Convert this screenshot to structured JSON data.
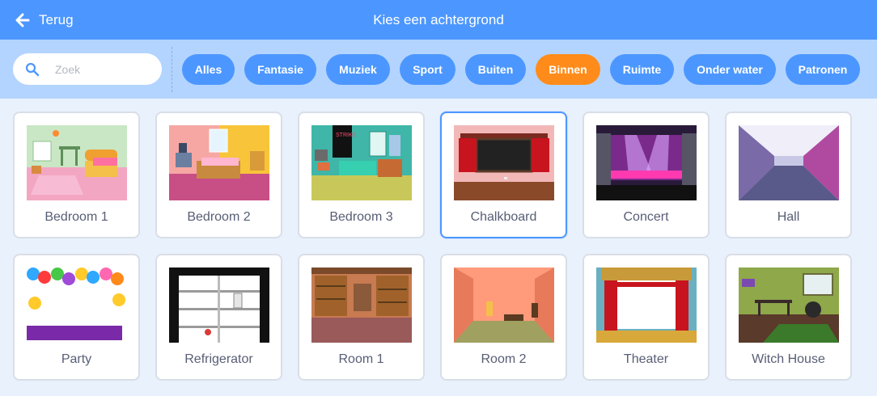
{
  "header": {
    "back_label": "Terug",
    "title": "Kies een achtergrond"
  },
  "search": {
    "placeholder": "Zoek",
    "value": ""
  },
  "tags": [
    {
      "label": "Alles",
      "active": false
    },
    {
      "label": "Fantasie",
      "active": false
    },
    {
      "label": "Muziek",
      "active": false
    },
    {
      "label": "Sport",
      "active": false
    },
    {
      "label": "Buiten",
      "active": false
    },
    {
      "label": "Binnen",
      "active": true
    },
    {
      "label": "Ruimte",
      "active": false
    },
    {
      "label": "Onder water",
      "active": false
    },
    {
      "label": "Patronen",
      "active": false
    }
  ],
  "backdrops": [
    {
      "name": "Bedroom 1",
      "selected": false
    },
    {
      "name": "Bedroom 2",
      "selected": false
    },
    {
      "name": "Bedroom 3",
      "selected": false
    },
    {
      "name": "Chalkboard",
      "selected": true
    },
    {
      "name": "Concert",
      "selected": false
    },
    {
      "name": "Hall",
      "selected": false
    },
    {
      "name": "Party",
      "selected": false
    },
    {
      "name": "Refrigerator",
      "selected": false
    },
    {
      "name": "Room 1",
      "selected": false
    },
    {
      "name": "Room 2",
      "selected": false
    },
    {
      "name": "Theater",
      "selected": false
    },
    {
      "name": "Witch House",
      "selected": false
    }
  ],
  "colors": {
    "header_bg": "#4c97ff",
    "filter_bg": "#b3d4ff",
    "tag_bg": "#4c97ff",
    "tag_active_bg": "#ff8c1a",
    "page_bg": "#e9f1fc",
    "card_border": "#d9dee7",
    "card_selected_border": "#4c97ff",
    "label_text": "#575e75"
  },
  "icons": {
    "back": "arrow-left-icon",
    "search": "magnifier-icon"
  }
}
